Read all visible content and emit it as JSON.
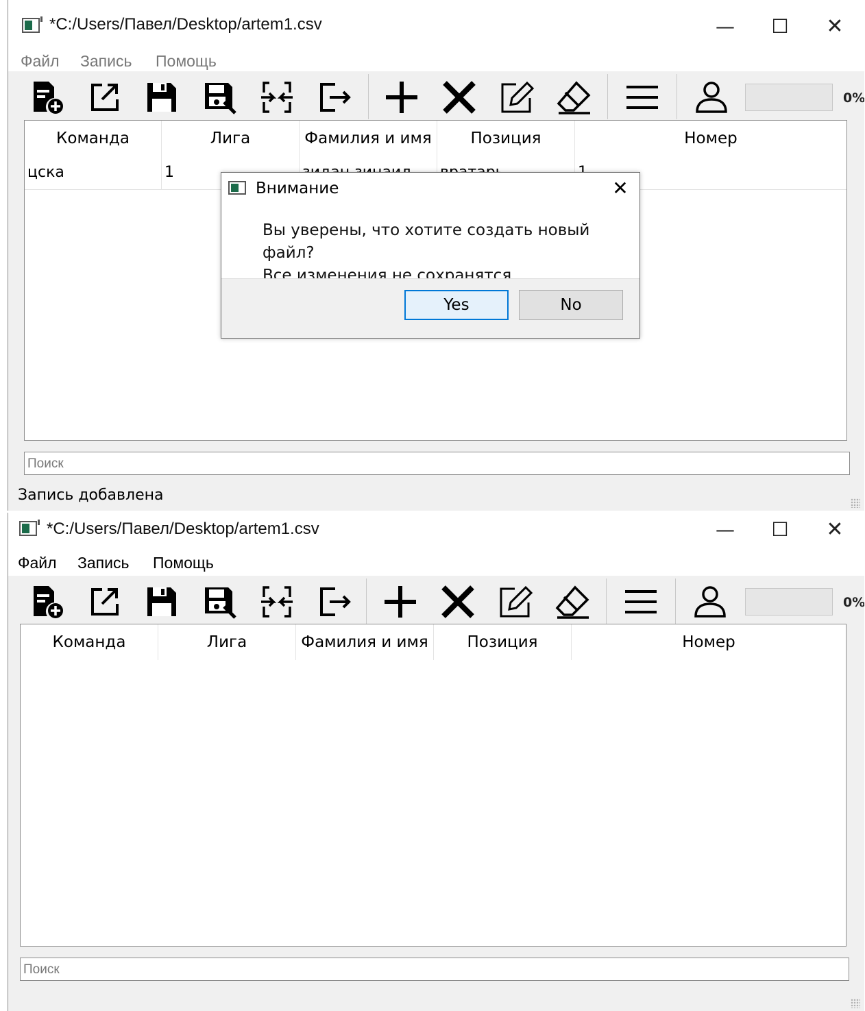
{
  "window_title": "*C:/Users/Павел/Desktop/artem1.csv",
  "window_controls": {
    "minimize": "—",
    "maximize": "☐",
    "close": "✕"
  },
  "menu": [
    "Файл",
    "Запись",
    "Помощь"
  ],
  "toolbar": {
    "buttons": [
      "new-file",
      "open-external",
      "save",
      "save-as",
      "merge",
      "exit",
      "add-record",
      "delete-record",
      "edit-record",
      "clear",
      "menu",
      "user"
    ],
    "progress_percent": "0%"
  },
  "table": {
    "columns": [
      "Команда",
      "Лига",
      "Фамилия и имя",
      "Позиция",
      "Номер"
    ],
    "rows": [
      [
        "цска",
        "1",
        "зидан зинаид",
        "вратарь",
        "1"
      ]
    ]
  },
  "search_placeholder": "Поиск",
  "status_text": "Запись добавлена",
  "dialog": {
    "title": "Внимание",
    "close": "✕",
    "message_line1": "Вы уверены, что хотите создать новый файл?",
    "message_line2": "Все изменения не сохранятся",
    "yes_label": "Yes",
    "no_label": "No"
  },
  "colors": {
    "accent": "#0078d7",
    "app_icon": "#1b6b4a"
  }
}
